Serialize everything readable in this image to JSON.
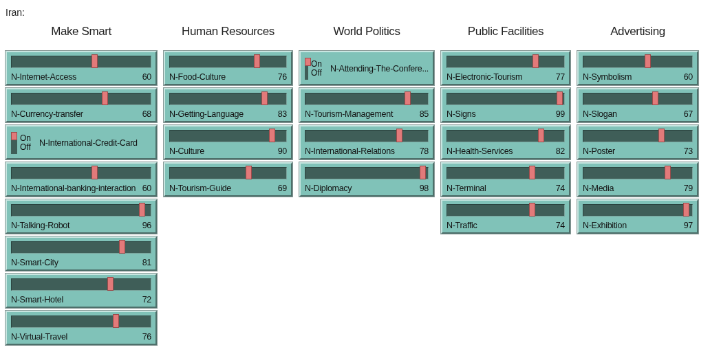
{
  "title": "Iran:",
  "groups": [
    {
      "heading": "Make Smart",
      "widgets": [
        {
          "kind": "slider",
          "label": "N-Internet-Access",
          "value": "60",
          "level": 0.6
        },
        {
          "kind": "slider",
          "label": "N-Currency-transfer",
          "value": "68",
          "level": 0.68
        },
        {
          "kind": "switch",
          "label": "N-International-Credit-Card",
          "on": true,
          "on_text": "On",
          "off_text": "Off"
        },
        {
          "kind": "slider",
          "label": "N-International-banking-interaction",
          "value": "60",
          "level": 0.6
        },
        {
          "kind": "slider",
          "label": "N-Talking-Robot",
          "value": "96",
          "level": 0.96
        },
        {
          "kind": "slider",
          "label": "N-Smart-City",
          "value": "81",
          "level": 0.81
        },
        {
          "kind": "slider",
          "label": "N-Smart-Hotel",
          "value": "72",
          "level": 0.72
        },
        {
          "kind": "slider",
          "label": "N-Virtual-Travel",
          "value": "76",
          "level": 0.76
        }
      ]
    },
    {
      "heading": "Human Resources",
      "widgets": [
        {
          "kind": "slider",
          "label": "N-Food-Culture",
          "value": "76",
          "level": 0.76
        },
        {
          "kind": "slider",
          "label": "N-Getting-Language",
          "value": "83",
          "level": 0.83
        },
        {
          "kind": "slider",
          "label": "N-Culture",
          "value": "90",
          "level": 0.9
        },
        {
          "kind": "slider",
          "label": "N-Tourism-Guide",
          "value": "69",
          "level": 0.69
        }
      ]
    },
    {
      "heading": "World Politics",
      "widgets": [
        {
          "kind": "switch",
          "label": "N-Attending-The-Confere...",
          "on": true,
          "on_text": "On",
          "off_text": "Off"
        },
        {
          "kind": "slider",
          "label": "N-Tourism-Management",
          "value": "85",
          "level": 0.85
        },
        {
          "kind": "slider",
          "label": "N-International-Relations",
          "value": "78",
          "level": 0.78
        },
        {
          "kind": "slider",
          "label": "N-Diplomacy",
          "value": "98",
          "level": 0.98
        }
      ]
    },
    {
      "heading": "Public Facilities",
      "widgets": [
        {
          "kind": "slider",
          "label": "N-Electronic-Tourism",
          "value": "77",
          "level": 0.77
        },
        {
          "kind": "slider",
          "label": "N-Signs",
          "value": "99",
          "level": 0.99
        },
        {
          "kind": "slider",
          "label": "N-Health-Services",
          "value": "82",
          "level": 0.82
        },
        {
          "kind": "slider",
          "label": "N-Terminal",
          "value": "74",
          "level": 0.74
        },
        {
          "kind": "slider",
          "label": "N-Traffic",
          "value": "74",
          "level": 0.74
        }
      ]
    },
    {
      "heading": "Advertising",
      "widgets": [
        {
          "kind": "slider",
          "label": "N-Symbolism",
          "value": "60",
          "level": 0.6
        },
        {
          "kind": "slider",
          "label": "N-Slogan",
          "value": "67",
          "level": 0.67
        },
        {
          "kind": "slider",
          "label": "N-Poster",
          "value": "73",
          "level": 0.73
        },
        {
          "kind": "slider",
          "label": "N-Media",
          "value": "79",
          "level": 0.79
        },
        {
          "kind": "slider",
          "label": "N-Exhibition",
          "value": "97",
          "level": 0.97
        }
      ]
    }
  ]
}
